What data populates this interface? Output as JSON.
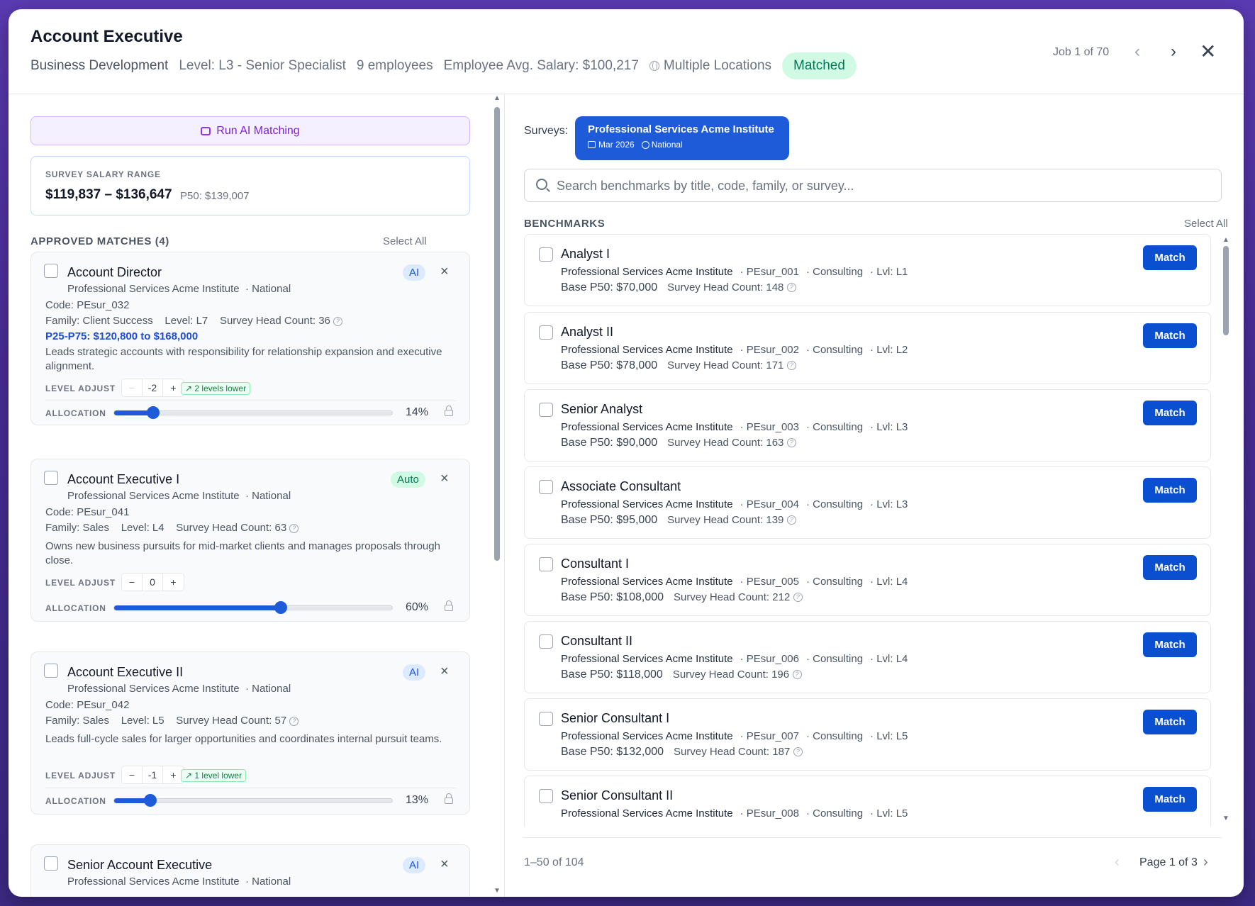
{
  "header": {
    "title": "Account Executive",
    "department": "Business Development",
    "level": "Level: L3 - Senior Specialist",
    "employees": "9 employees",
    "avg_salary": "Employee Avg. Salary: $100,217",
    "locations": "Multiple Locations",
    "status_badge": "Matched",
    "job_counter": "Job 1 of 70",
    "prev_icon": "‹",
    "next_icon": "›",
    "close_icon": "✕"
  },
  "left": {
    "run_ai_label": "Run AI Matching",
    "salary_range": {
      "label": "SURVEY SALARY RANGE",
      "range": "$119,837 – $136,647",
      "p50": "P50: $139,007"
    },
    "approved_header": "APPROVED MATCHES (4)",
    "select_all": "Select All",
    "level_adjust_label": "LEVEL ADJUST",
    "allocation_label": "ALLOCATION",
    "matches": [
      {
        "title": "Account Director",
        "survey": "Professional Services Acme Institute",
        "scope": "· National",
        "badge": "AI",
        "code": "Code: PEsur_032",
        "family": "Family: Client Success",
        "level": "Level: L7",
        "headcount": "Survey Head Count: 36",
        "range": "P25-P75: $120,800 to $168,000",
        "description": "Leads strategic accounts with responsibility for relationship expansion and executive alignment.",
        "level_adjust": "-2",
        "level_tag": "↗ 2 levels lower",
        "allocation": "14%",
        "allocation_value": 14
      },
      {
        "title": "Account Executive I",
        "survey": "Professional Services Acme Institute",
        "scope": "· National",
        "badge": "Auto",
        "code": "Code: PEsur_041",
        "family": "Family: Sales",
        "level": "Level: L4",
        "headcount": "Survey Head Count: 63",
        "description": "Owns new business pursuits for mid-market clients and manages proposals through close.",
        "level_adjust": "0",
        "allocation": "60%",
        "allocation_value": 60
      },
      {
        "title": "Account Executive II",
        "survey": "Professional Services Acme Institute",
        "scope": "· National",
        "badge": "AI",
        "code": "Code: PEsur_042",
        "family": "Family: Sales",
        "level": "Level: L5",
        "headcount": "Survey Head Count: 57",
        "description": "Leads full-cycle sales for larger opportunities and coordinates internal pursuit teams.",
        "level_adjust": "-1",
        "level_tag": "↗ 1 level lower",
        "allocation": "13%",
        "allocation_value": 13
      },
      {
        "title": "Senior Account Executive",
        "survey": "Professional Services Acme Institute",
        "scope": "· National",
        "badge": "AI"
      }
    ]
  },
  "right": {
    "surveys_label": "Surveys:",
    "survey_chip": {
      "title": "Professional Services Acme Institute",
      "date": "Mar 2026",
      "scope": "National"
    },
    "search_placeholder": "Search benchmarks by title, code, family, or survey...",
    "benchmarks_header": "BENCHMARKS",
    "select_all": "Select All",
    "match_label": "Match",
    "benchmarks": [
      {
        "title": "Analyst I",
        "survey": "Professional Services Acme Institute",
        "code": "· PEsur_001",
        "family": "· Consulting",
        "level": "· Lvl: L1",
        "base": "Base P50: $70,000",
        "headcount": "Survey Head Count: 148"
      },
      {
        "title": "Analyst II",
        "survey": "Professional Services Acme Institute",
        "code": "· PEsur_002",
        "family": "· Consulting",
        "level": "· Lvl: L2",
        "base": "Base P50: $78,000",
        "headcount": "Survey Head Count: 171"
      },
      {
        "title": "Senior Analyst",
        "survey": "Professional Services Acme Institute",
        "code": "· PEsur_003",
        "family": "· Consulting",
        "level": "· Lvl: L3",
        "base": "Base P50: $90,000",
        "headcount": "Survey Head Count: 163"
      },
      {
        "title": "Associate Consultant",
        "survey": "Professional Services Acme Institute",
        "code": "· PEsur_004",
        "family": "· Consulting",
        "level": "· Lvl: L3",
        "base": "Base P50: $95,000",
        "headcount": "Survey Head Count: 139"
      },
      {
        "title": "Consultant I",
        "survey": "Professional Services Acme Institute",
        "code": "· PEsur_005",
        "family": "· Consulting",
        "level": "· Lvl: L4",
        "base": "Base P50: $108,000",
        "headcount": "Survey Head Count: 212"
      },
      {
        "title": "Consultant II",
        "survey": "Professional Services Acme Institute",
        "code": "· PEsur_006",
        "family": "· Consulting",
        "level": "· Lvl: L4",
        "base": "Base P50: $118,000",
        "headcount": "Survey Head Count: 196"
      },
      {
        "title": "Senior Consultant I",
        "survey": "Professional Services Acme Institute",
        "code": "· PEsur_007",
        "family": "· Consulting",
        "level": "· Lvl: L5",
        "base": "Base P50: $132,000",
        "headcount": "Survey Head Count: 187"
      },
      {
        "title": "Senior Consultant II",
        "survey": "Professional Services Acme Institute",
        "code": "· PEsur_008",
        "family": "· Consulting",
        "level": "· Lvl: L5",
        "base": "",
        "headcount": ""
      }
    ],
    "footer": {
      "count": "1–50 of 104",
      "page": "Page 1 of 3"
    }
  },
  "colors": {
    "accent": "#0b4fd1",
    "matched_bg": "#d1fae5",
    "matched_text": "#047857",
    "ai_purple": "#7e22ce"
  }
}
